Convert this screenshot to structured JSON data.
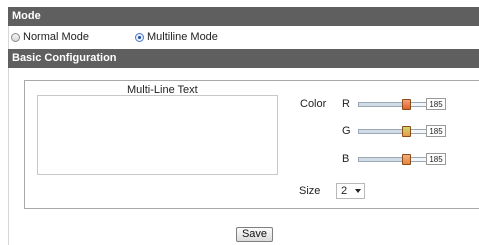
{
  "mode": {
    "header": "Mode",
    "options": [
      {
        "label": "Normal Mode",
        "selected": false
      },
      {
        "label": "Multiline Mode",
        "selected": true
      }
    ]
  },
  "basic_configuration": {
    "header": "Basic Configuration",
    "multi_line_label": "Multi-Line Text",
    "multi_line_value": "",
    "color_label": "Color",
    "channels": [
      {
        "label": "R",
        "value": "185",
        "level": 0.73
      },
      {
        "label": "G",
        "value": "185",
        "level": 0.73
      },
      {
        "label": "B",
        "value": "185",
        "level": 0.73
      }
    ],
    "size_label": "Size",
    "size_value": "2"
  },
  "save_label": "Save"
}
